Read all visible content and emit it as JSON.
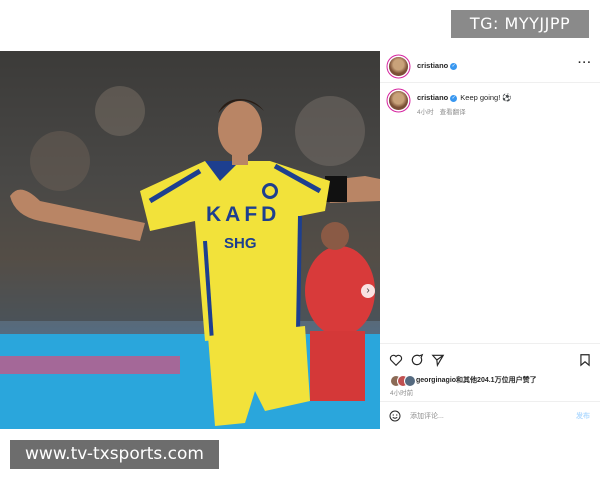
{
  "watermarks": {
    "top": "TG: MYYJJPP",
    "bottom": "www.tv-txsports.com"
  },
  "post": {
    "username": "cristiano",
    "caption_username": "cristiano",
    "caption_text": "Keep going! ⚽",
    "time_ago": "4小时",
    "see_translation": "查看翻译",
    "likes_text": "georginagio和其他204.1万位用户赞了",
    "likes_time": "4小时前",
    "comment_placeholder": "添加评论...",
    "post_button": "发布",
    "more_label": "···"
  },
  "photo": {
    "jersey_sponsor": "KAFD",
    "jersey_sponsor2": "SHG",
    "next_arrow": "›"
  },
  "colors": {
    "jersey": "#f2e23a",
    "jersey_trim": "#1d3f8f",
    "verified": "#3897f0"
  }
}
